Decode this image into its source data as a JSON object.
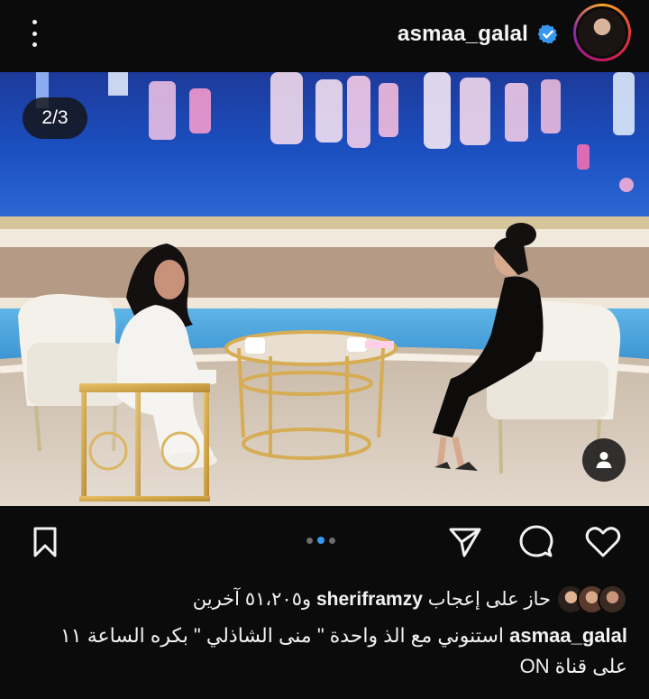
{
  "header": {
    "username": "asmaa_galal",
    "verified": true,
    "more_icon": "more-vertical-icon",
    "avatar_icon": "profile-avatar"
  },
  "media": {
    "counter": "2/3",
    "description_icon": "talk-show-studio-photo",
    "user_tag_icon": "person-icon",
    "carousel": {
      "total": 3,
      "current": 2
    }
  },
  "actions": {
    "like_icon": "heart-icon",
    "comment_icon": "comment-icon",
    "share_icon": "send-icon",
    "save_icon": "bookmark-icon"
  },
  "likes": {
    "prefix": "حاز على إعجاب",
    "user": "sheriframzy",
    "suffix": "و٥١،٢٠٥ آخرين"
  },
  "caption": {
    "user": "asmaa_galal",
    "text": "استنوني مع الذ واحدة \" منى الشاذلي \" بكره الساعة ١١ على قناة ON"
  },
  "colors": {
    "background": "#0b0b0b",
    "accent_blue": "#3897f0",
    "verified_blue": "#3897f0"
  }
}
